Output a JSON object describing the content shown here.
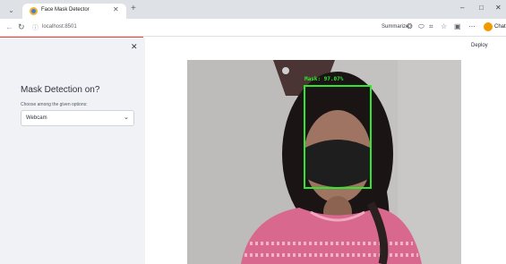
{
  "browser": {
    "tab_title": "Face Mask Detector",
    "url": "localhost:8501",
    "summarize_label": "Summarize",
    "chat_label": "Chat",
    "icons": [
      "chevron-down-icon",
      "close-icon",
      "plus-icon",
      "minimize-icon",
      "maximize-icon",
      "back-icon",
      "reload-icon",
      "info-icon",
      "summarize-icon",
      "star-icon",
      "bookmark-icon",
      "extensions-icon",
      "more-icon"
    ]
  },
  "app": {
    "deploy_label": "Deploy",
    "sidebar": {
      "heading": "Mask Detection on?",
      "select_caption": "Choose among the given options:",
      "select_value": "Webcam"
    },
    "detection": {
      "label": "Mask: 97.07%",
      "box_color": "#2ee82e"
    }
  }
}
